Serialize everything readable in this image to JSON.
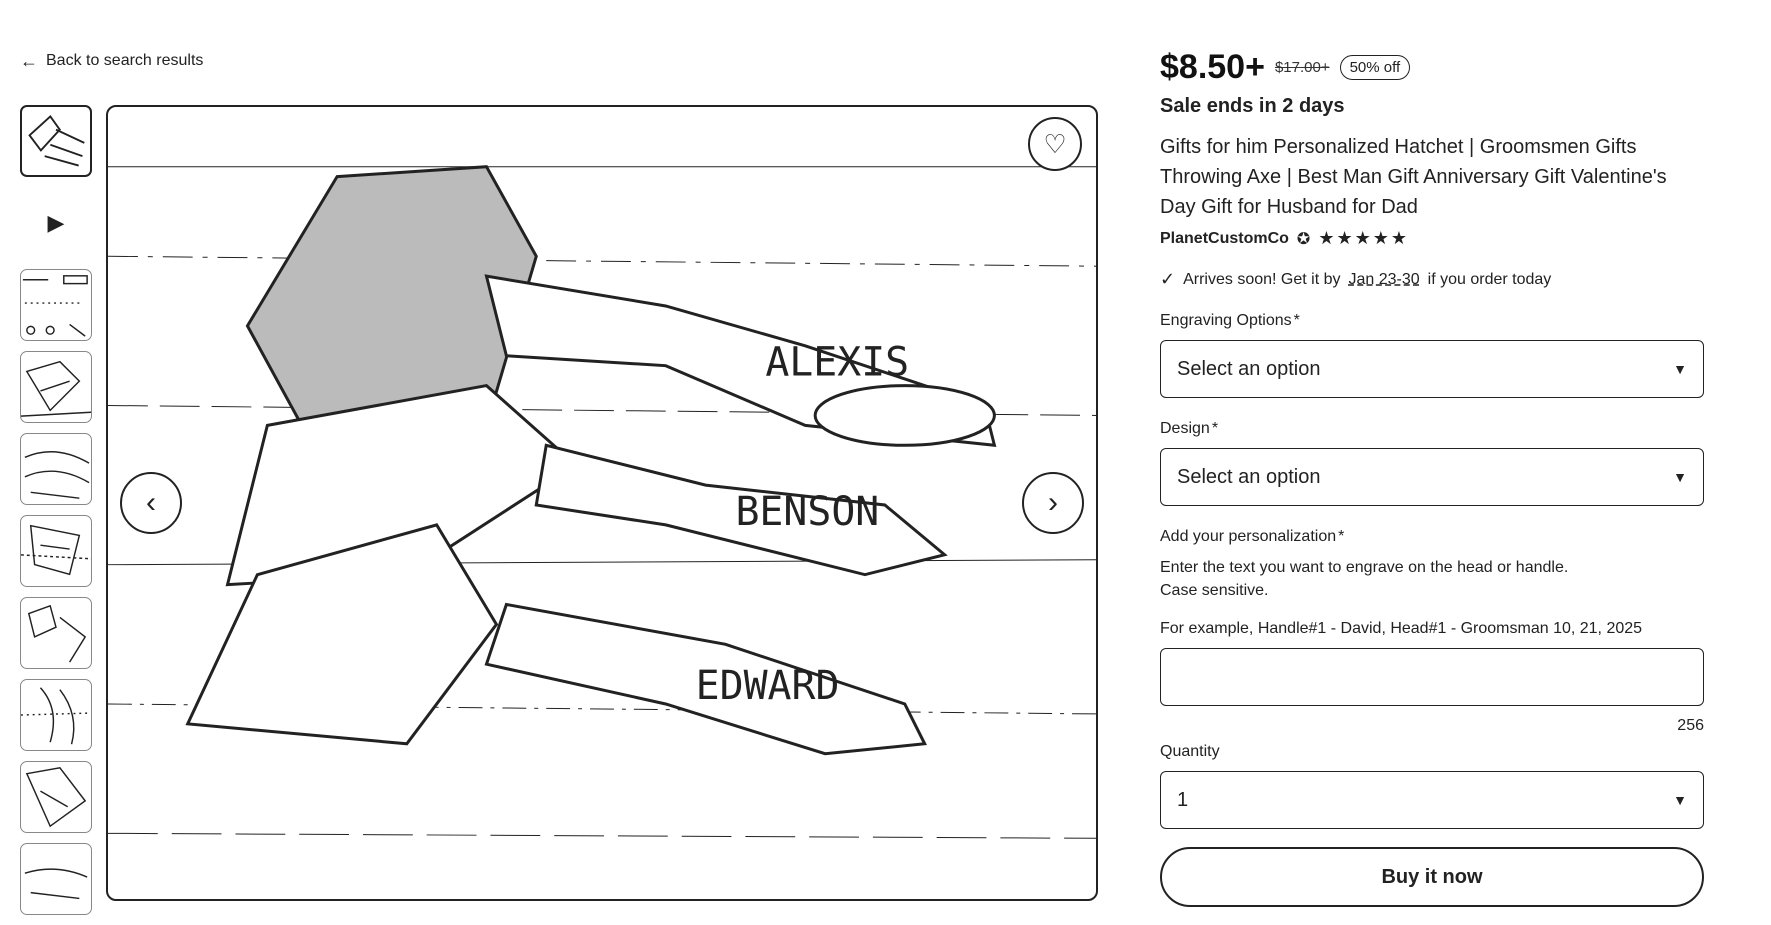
{
  "nav": {
    "back_label": "Back to search results"
  },
  "listing": {
    "price": "$8.50+",
    "original_price": "$17.00+",
    "discount_badge": "50% off",
    "sale_ends": "Sale ends in 2 days",
    "title": "Gifts for him Personalized Hatchet | Groomsmen Gifts Throwing Axe | Best Man Gift Anniversary Gift Valentine's Day Gift for Husband for Dad",
    "shop_name": "PlanetCustomCo",
    "rating_stars": "★★★★★",
    "rating_value": 5
  },
  "delivery": {
    "prefix": "Arrives soon! Get it by",
    "date": "Jan 23-30",
    "suffix": "if you order today"
  },
  "options": {
    "engraving": {
      "label": "Engraving Options",
      "required": "*",
      "value": "Select an option"
    },
    "design": {
      "label": "Design",
      "required": "*",
      "value": "Select an option"
    },
    "personalization": {
      "label": "Add your personalization",
      "required": "*",
      "help_line1": "Enter the text you want to engrave on the head or handle.",
      "help_line2": "Case sensitive.",
      "example": "For example, Handle#1 - David, Head#1 - Groomsman 10, 21, 2025",
      "value": "",
      "char_count": "256"
    },
    "quantity": {
      "label": "Quantity",
      "value": "1"
    }
  },
  "cta": {
    "buy_label": "Buy it now"
  },
  "icons": {
    "back": "←",
    "play": "▶",
    "heart": "♡",
    "prev": "‹",
    "next": "›",
    "caret": "▼",
    "check": "✓",
    "star_seller": "✪"
  },
  "gallery": {
    "thumbnail_count": 10,
    "active_index": 0
  }
}
